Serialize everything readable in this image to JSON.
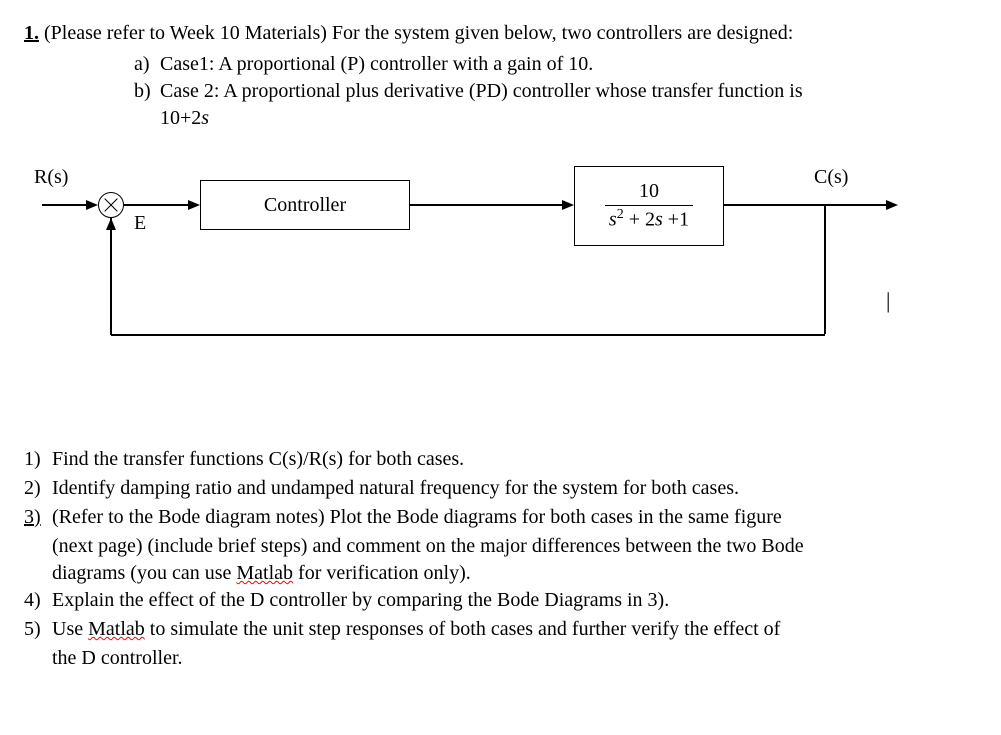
{
  "header": {
    "number": "1.",
    "text": "(Please refer to Week 10 Materials) For the system given below, two controllers are designed:"
  },
  "cases": {
    "a": {
      "label": "a)",
      "text": "Case1: A proportional (P) controller with a gain of 10."
    },
    "b": {
      "label": "b)",
      "line1": "Case 2: A proportional plus derivative (PD) controller whose transfer function is",
      "line2_prefix": "10+2",
      "line2_suffix": "s"
    }
  },
  "diagram": {
    "R": "R(s)",
    "E": "E",
    "C": "C(s)",
    "controller": "Controller",
    "plant_num": "10",
    "plant_den_prefix": "s",
    "plant_den_mid": " + 2",
    "plant_den_s": "s",
    "plant_den_end": " +1"
  },
  "questions": {
    "1": {
      "n": "1)",
      "t": "Find the transfer functions C(s)/R(s) for both cases."
    },
    "2": {
      "n": "2)",
      "t": "Identify damping ratio and undamped natural frequency for the system for both cases."
    },
    "3": {
      "n": "3)",
      "t1": "(Refer to the Bode diagram notes) Plot the Bode diagrams for both cases in the same figure",
      "c1a": "(next page) (include brief steps) and comment on the major differences between the two Bode",
      "c2a": "diagrams (you can use ",
      "matlab": "Matlab",
      "c2b": " for verification only)."
    },
    "4": {
      "n": "4)",
      "t": "Explain the effect of the D controller by comparing the Bode Diagrams in 3)."
    },
    "5": {
      "n": "5)",
      "t1a": "Use ",
      "matlab": "Matlab",
      "t1b": " to simulate the unit step responses of both cases and further verify the effect of",
      "c": "the D controller."
    }
  }
}
